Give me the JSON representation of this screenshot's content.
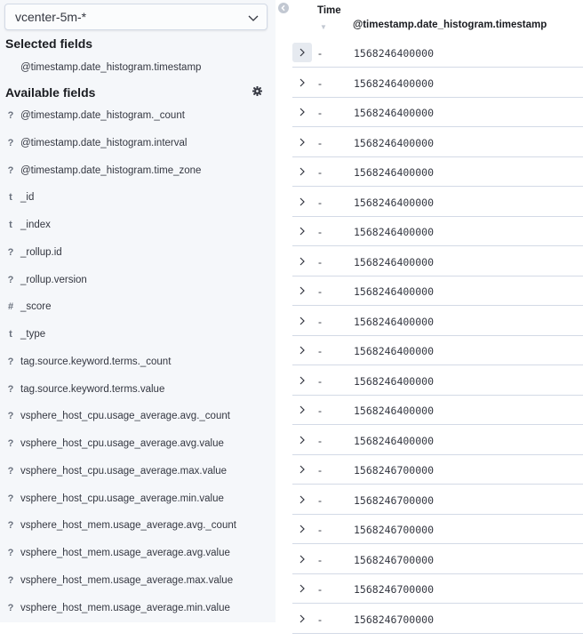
{
  "sidebar": {
    "index_pattern": "vcenter-5m-*",
    "selected_title": "Selected fields",
    "available_title": "Available fields",
    "selected_fields": [
      {
        "type": "",
        "name": "@timestamp.date_histogram.timestamp"
      }
    ],
    "available_fields": [
      {
        "type": "?",
        "name": "@timestamp.date_histogram._count"
      },
      {
        "type": "?",
        "name": "@timestamp.date_histogram.interval"
      },
      {
        "type": "?",
        "name": "@timestamp.date_histogram.time_zone"
      },
      {
        "type": "t",
        "name": "_id"
      },
      {
        "type": "t",
        "name": "_index"
      },
      {
        "type": "?",
        "name": "_rollup.id"
      },
      {
        "type": "?",
        "name": "_rollup.version"
      },
      {
        "type": "#",
        "name": "_score"
      },
      {
        "type": "t",
        "name": "_type"
      },
      {
        "type": "?",
        "name": "tag.source.keyword.terms._count"
      },
      {
        "type": "?",
        "name": "tag.source.keyword.terms.value"
      },
      {
        "type": "?",
        "name": "vsphere_host_cpu.usage_average.avg._count"
      },
      {
        "type": "?",
        "name": "vsphere_host_cpu.usage_average.avg.value"
      },
      {
        "type": "?",
        "name": "vsphere_host_cpu.usage_average.max.value"
      },
      {
        "type": "?",
        "name": "vsphere_host_cpu.usage_average.min.value"
      },
      {
        "type": "?",
        "name": "vsphere_host_mem.usage_average.avg._count"
      },
      {
        "type": "?",
        "name": "vsphere_host_mem.usage_average.avg.value"
      },
      {
        "type": "?",
        "name": "vsphere_host_mem.usage_average.max.value"
      },
      {
        "type": "?",
        "name": "vsphere_host_mem.usage_average.min.value"
      }
    ],
    "icons": {
      "dropdown": "chevron-down-icon",
      "settings": "gear-icon",
      "collapse": "chevron-left-circle-icon"
    }
  },
  "table": {
    "columns": [
      "Time",
      "@timestamp.date_histogram.timestamp"
    ],
    "rows": [
      {
        "time": "-",
        "timestamp": "1568246400000"
      },
      {
        "time": "-",
        "timestamp": "1568246400000"
      },
      {
        "time": "-",
        "timestamp": "1568246400000"
      },
      {
        "time": "-",
        "timestamp": "1568246400000"
      },
      {
        "time": "-",
        "timestamp": "1568246400000"
      },
      {
        "time": "-",
        "timestamp": "1568246400000"
      },
      {
        "time": "-",
        "timestamp": "1568246400000"
      },
      {
        "time": "-",
        "timestamp": "1568246400000"
      },
      {
        "time": "-",
        "timestamp": "1568246400000"
      },
      {
        "time": "-",
        "timestamp": "1568246400000"
      },
      {
        "time": "-",
        "timestamp": "1568246400000"
      },
      {
        "time": "-",
        "timestamp": "1568246400000"
      },
      {
        "time": "-",
        "timestamp": "1568246400000"
      },
      {
        "time": "-",
        "timestamp": "1568246400000"
      },
      {
        "time": "-",
        "timestamp": "1568246700000"
      },
      {
        "time": "-",
        "timestamp": "1568246700000"
      },
      {
        "time": "-",
        "timestamp": "1568246700000"
      },
      {
        "time": "-",
        "timestamp": "1568246700000"
      },
      {
        "time": "-",
        "timestamp": "1568246700000"
      },
      {
        "time": "-",
        "timestamp": "1568246700000"
      }
    ]
  },
  "colors": {
    "sidebar_bg": "#f5f7fa",
    "border": "#d3dae6",
    "text": "#343741",
    "muted": "#69707d"
  }
}
